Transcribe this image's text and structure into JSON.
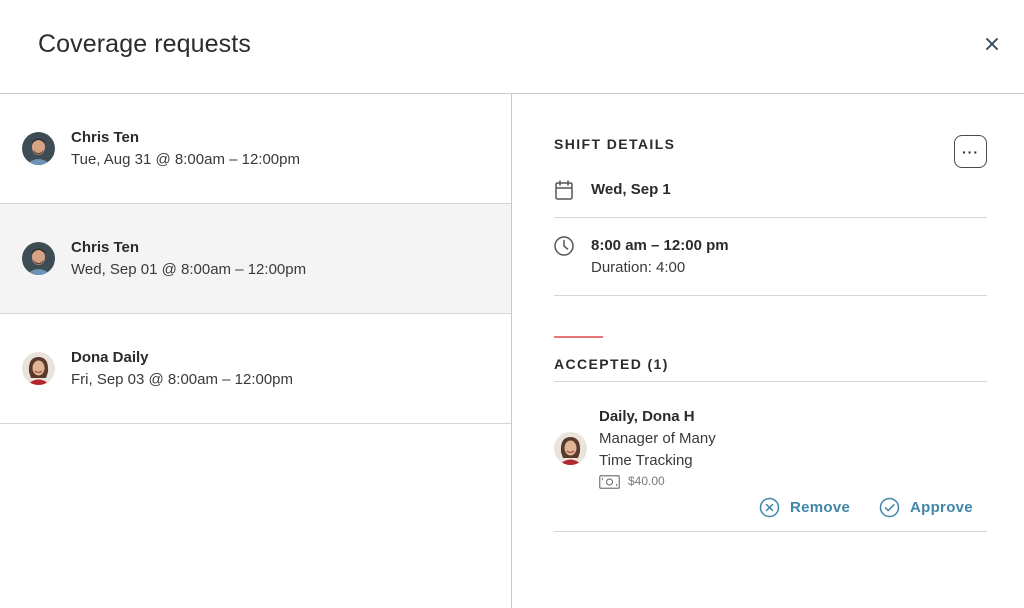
{
  "header": {
    "title": "Coverage requests",
    "close_icon": "close-icon"
  },
  "requests": [
    {
      "name": "Chris Ten",
      "when": "Tue, Aug 31 @ 8:00am – 12:00pm",
      "avatar": "male"
    },
    {
      "name": "Chris Ten",
      "when": "Wed, Sep 01 @ 8:00am – 12:00pm",
      "avatar": "male"
    },
    {
      "name": "Dona Daily",
      "when": "Fri, Sep 03 @ 8:00am – 12:00pm",
      "avatar": "female"
    }
  ],
  "selected_index": 1,
  "details": {
    "section_title": "SHIFT DETAILS",
    "more_label": "···",
    "date": "Wed, Sep 1",
    "time": "8:00 am – 12:00 pm",
    "duration": "Duration: 4:00"
  },
  "accepted": {
    "title": "ACCEPTED (1)",
    "employee": {
      "name": "Daily, Dona H",
      "role": "Manager of Many",
      "department": "Time Tracking",
      "pay": "$40.00"
    },
    "remove_label": "Remove",
    "approve_label": "Approve"
  },
  "colors": {
    "accent": "#3f86a8",
    "red_accent": "#e8777a",
    "selected_bg": "#f4f4f4"
  }
}
